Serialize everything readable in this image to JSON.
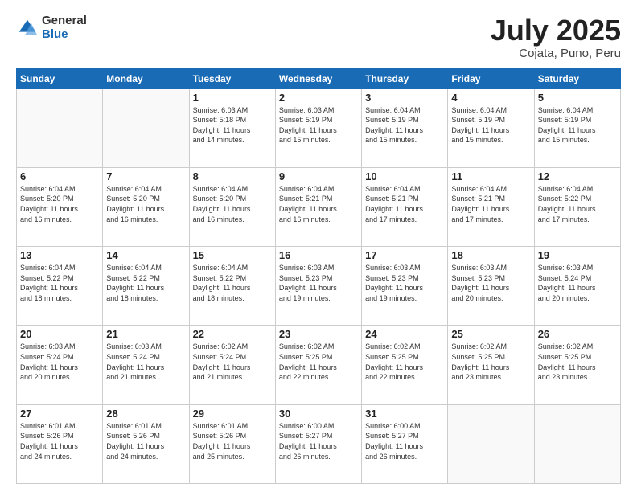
{
  "header": {
    "logo_general": "General",
    "logo_blue": "Blue",
    "title": "July 2025",
    "location": "Cojata, Puno, Peru"
  },
  "days_of_week": [
    "Sunday",
    "Monday",
    "Tuesday",
    "Wednesday",
    "Thursday",
    "Friday",
    "Saturday"
  ],
  "weeks": [
    [
      {
        "day": "",
        "info": ""
      },
      {
        "day": "",
        "info": ""
      },
      {
        "day": "1",
        "info": "Sunrise: 6:03 AM\nSunset: 5:18 PM\nDaylight: 11 hours\nand 14 minutes."
      },
      {
        "day": "2",
        "info": "Sunrise: 6:03 AM\nSunset: 5:19 PM\nDaylight: 11 hours\nand 15 minutes."
      },
      {
        "day": "3",
        "info": "Sunrise: 6:04 AM\nSunset: 5:19 PM\nDaylight: 11 hours\nand 15 minutes."
      },
      {
        "day": "4",
        "info": "Sunrise: 6:04 AM\nSunset: 5:19 PM\nDaylight: 11 hours\nand 15 minutes."
      },
      {
        "day": "5",
        "info": "Sunrise: 6:04 AM\nSunset: 5:19 PM\nDaylight: 11 hours\nand 15 minutes."
      }
    ],
    [
      {
        "day": "6",
        "info": "Sunrise: 6:04 AM\nSunset: 5:20 PM\nDaylight: 11 hours\nand 16 minutes."
      },
      {
        "day": "7",
        "info": "Sunrise: 6:04 AM\nSunset: 5:20 PM\nDaylight: 11 hours\nand 16 minutes."
      },
      {
        "day": "8",
        "info": "Sunrise: 6:04 AM\nSunset: 5:20 PM\nDaylight: 11 hours\nand 16 minutes."
      },
      {
        "day": "9",
        "info": "Sunrise: 6:04 AM\nSunset: 5:21 PM\nDaylight: 11 hours\nand 16 minutes."
      },
      {
        "day": "10",
        "info": "Sunrise: 6:04 AM\nSunset: 5:21 PM\nDaylight: 11 hours\nand 17 minutes."
      },
      {
        "day": "11",
        "info": "Sunrise: 6:04 AM\nSunset: 5:21 PM\nDaylight: 11 hours\nand 17 minutes."
      },
      {
        "day": "12",
        "info": "Sunrise: 6:04 AM\nSunset: 5:22 PM\nDaylight: 11 hours\nand 17 minutes."
      }
    ],
    [
      {
        "day": "13",
        "info": "Sunrise: 6:04 AM\nSunset: 5:22 PM\nDaylight: 11 hours\nand 18 minutes."
      },
      {
        "day": "14",
        "info": "Sunrise: 6:04 AM\nSunset: 5:22 PM\nDaylight: 11 hours\nand 18 minutes."
      },
      {
        "day": "15",
        "info": "Sunrise: 6:04 AM\nSunset: 5:22 PM\nDaylight: 11 hours\nand 18 minutes."
      },
      {
        "day": "16",
        "info": "Sunrise: 6:03 AM\nSunset: 5:23 PM\nDaylight: 11 hours\nand 19 minutes."
      },
      {
        "day": "17",
        "info": "Sunrise: 6:03 AM\nSunset: 5:23 PM\nDaylight: 11 hours\nand 19 minutes."
      },
      {
        "day": "18",
        "info": "Sunrise: 6:03 AM\nSunset: 5:23 PM\nDaylight: 11 hours\nand 20 minutes."
      },
      {
        "day": "19",
        "info": "Sunrise: 6:03 AM\nSunset: 5:24 PM\nDaylight: 11 hours\nand 20 minutes."
      }
    ],
    [
      {
        "day": "20",
        "info": "Sunrise: 6:03 AM\nSunset: 5:24 PM\nDaylight: 11 hours\nand 20 minutes."
      },
      {
        "day": "21",
        "info": "Sunrise: 6:03 AM\nSunset: 5:24 PM\nDaylight: 11 hours\nand 21 minutes."
      },
      {
        "day": "22",
        "info": "Sunrise: 6:02 AM\nSunset: 5:24 PM\nDaylight: 11 hours\nand 21 minutes."
      },
      {
        "day": "23",
        "info": "Sunrise: 6:02 AM\nSunset: 5:25 PM\nDaylight: 11 hours\nand 22 minutes."
      },
      {
        "day": "24",
        "info": "Sunrise: 6:02 AM\nSunset: 5:25 PM\nDaylight: 11 hours\nand 22 minutes."
      },
      {
        "day": "25",
        "info": "Sunrise: 6:02 AM\nSunset: 5:25 PM\nDaylight: 11 hours\nand 23 minutes."
      },
      {
        "day": "26",
        "info": "Sunrise: 6:02 AM\nSunset: 5:25 PM\nDaylight: 11 hours\nand 23 minutes."
      }
    ],
    [
      {
        "day": "27",
        "info": "Sunrise: 6:01 AM\nSunset: 5:26 PM\nDaylight: 11 hours\nand 24 minutes."
      },
      {
        "day": "28",
        "info": "Sunrise: 6:01 AM\nSunset: 5:26 PM\nDaylight: 11 hours\nand 24 minutes."
      },
      {
        "day": "29",
        "info": "Sunrise: 6:01 AM\nSunset: 5:26 PM\nDaylight: 11 hours\nand 25 minutes."
      },
      {
        "day": "30",
        "info": "Sunrise: 6:00 AM\nSunset: 5:27 PM\nDaylight: 11 hours\nand 26 minutes."
      },
      {
        "day": "31",
        "info": "Sunrise: 6:00 AM\nSunset: 5:27 PM\nDaylight: 11 hours\nand 26 minutes."
      },
      {
        "day": "",
        "info": ""
      },
      {
        "day": "",
        "info": ""
      }
    ]
  ]
}
